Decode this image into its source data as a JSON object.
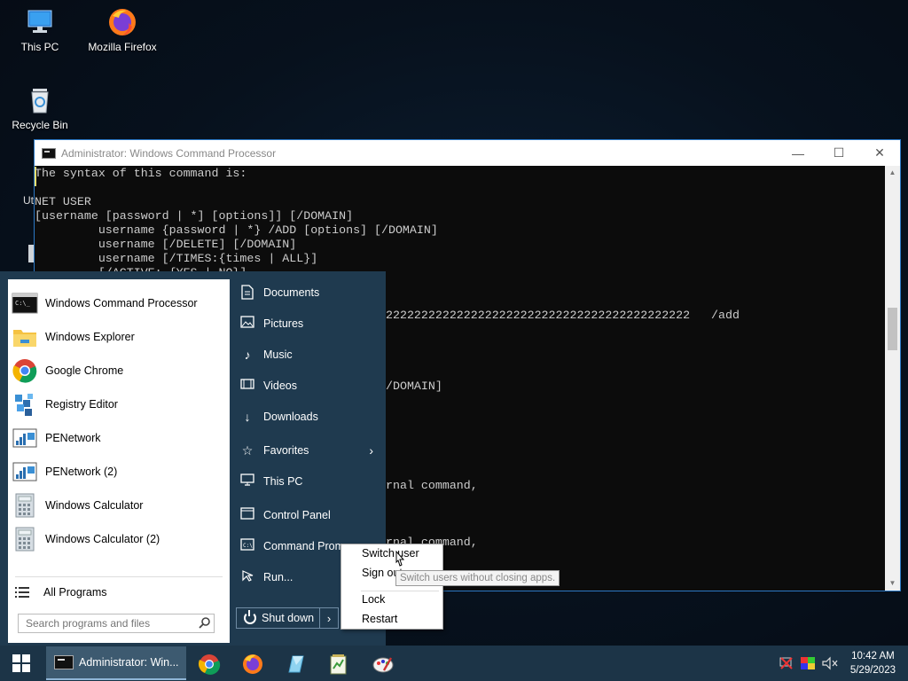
{
  "desktop": {
    "icons": [
      {
        "label": "This PC"
      },
      {
        "label": "Mozilla Firefox"
      },
      {
        "label": "Recycle Bin"
      }
    ],
    "partial_label": "Ut"
  },
  "cmd_window": {
    "title": "Administrator: Windows Command Processor",
    "controls": {
      "minimize": "—",
      "maximize": "☐",
      "close": "✕"
    },
    "lines": [
      "The syntax of this command is:",
      "",
      "NET USER",
      "[username [password | *] [options]] [/DOMAIN]",
      "         username {password | *} /ADD [options] [/DOMAIN]",
      "         username [/DELETE] [/DOMAIN]",
      "         username [/TIMES:{times | ALL}]",
      "         [/ACTIVE: {YES | NO}]"
    ],
    "fragments": {
      "f1": "2222222222222222222222222222222222222222222   /add",
      "f2": "/DOMAIN]",
      "f3": "rnal command,",
      "f4": "rnal command,"
    }
  },
  "start_menu": {
    "programs": [
      {
        "label": "Windows Command Processor",
        "icon": "cmd-icon"
      },
      {
        "label": "Windows Explorer",
        "icon": "folder-icon"
      },
      {
        "label": "Google Chrome",
        "icon": "chrome-icon"
      },
      {
        "label": "Registry Editor",
        "icon": "registry-icon"
      },
      {
        "label": "PENetwork",
        "icon": "network-icon"
      },
      {
        "label": "PENetwork (2)",
        "icon": "network-icon"
      },
      {
        "label": "Windows Calculator",
        "icon": "calculator-icon"
      },
      {
        "label": "Windows Calculator (2)",
        "icon": "calculator-icon"
      }
    ],
    "all_programs": "All Programs",
    "search_placeholder": "Search programs and files",
    "places": [
      {
        "label": "Documents",
        "icon": "document-icon"
      },
      {
        "label": "Pictures",
        "icon": "picture-icon"
      },
      {
        "label": "Music",
        "icon": "music-icon"
      },
      {
        "label": "Videos",
        "icon": "video-icon"
      },
      {
        "label": "Downloads",
        "icon": "download-icon"
      },
      {
        "label": "Favorites",
        "icon": "star-icon"
      },
      {
        "label": "This PC",
        "icon": "computer-icon"
      },
      {
        "label": "Control Panel",
        "icon": "control-panel-icon"
      },
      {
        "label": "Command Prom",
        "icon": "cmd-icon"
      },
      {
        "label": "Run...",
        "icon": "run-icon"
      }
    ],
    "shutdown_label": "Shut down",
    "shutdown_arrow": "›"
  },
  "context_menu": {
    "items": [
      "Switch user",
      "Sign out",
      "Lock",
      "Restart"
    ],
    "tooltip": "Switch users without closing apps."
  },
  "taskbar": {
    "active_task": "Administrator: Win...",
    "time": "10:42 AM",
    "date": "5/29/2023"
  }
}
